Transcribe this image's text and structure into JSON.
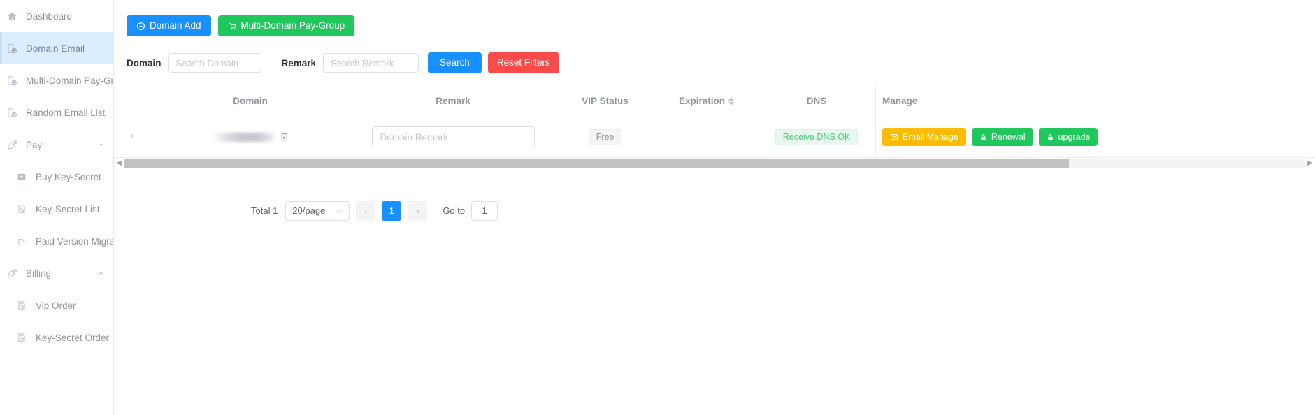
{
  "sidebar": {
    "items": [
      {
        "label": "Dashboard",
        "icon": "home-icon",
        "level": "top",
        "active": false
      },
      {
        "label": "Domain Email",
        "icon": "domain-email-icon",
        "level": "top",
        "active": true
      },
      {
        "label": "Multi-Domain Pay-Group",
        "icon": "domain-email-icon",
        "level": "top",
        "active": false
      },
      {
        "label": "Random Email List",
        "icon": "domain-email-icon",
        "level": "top",
        "active": false
      },
      {
        "label": "Pay",
        "icon": "pay-icon",
        "level": "group",
        "active": false,
        "expanded": true
      },
      {
        "label": "Buy Key-Secret",
        "icon": "key-buy-icon",
        "level": "sub",
        "active": false
      },
      {
        "label": "Key-Secret List",
        "icon": "list-icon",
        "level": "sub",
        "active": false
      },
      {
        "label": "Paid Version Migration",
        "icon": "migration-icon",
        "level": "sub",
        "active": false
      },
      {
        "label": "Billing",
        "icon": "pay-icon",
        "level": "group",
        "active": false,
        "expanded": true
      },
      {
        "label": "Vip Order",
        "icon": "list-icon",
        "level": "sub",
        "active": false
      },
      {
        "label": "Key-Secret Order",
        "icon": "list-icon",
        "level": "sub",
        "active": false
      }
    ]
  },
  "toolbar": {
    "domain_add_label": "Domain Add",
    "multi_domain_label": "Multi-Domain Pay-Group"
  },
  "filters": {
    "domain_label": "Domain",
    "domain_placeholder": "Search Domain",
    "domain_value": "",
    "remark_label": "Remark",
    "remark_placeholder": "Search Remark",
    "remark_value": "",
    "search_label": "Search",
    "reset_label": "Reset Filters"
  },
  "table": {
    "columns": [
      {
        "key": "expander",
        "label": ""
      },
      {
        "key": "domain",
        "label": "Domain"
      },
      {
        "key": "remark",
        "label": "Remark"
      },
      {
        "key": "vip_status",
        "label": "VIP Status"
      },
      {
        "key": "expiration",
        "label": "Expiration",
        "sortable": true
      },
      {
        "key": "dns",
        "label": "DNS"
      },
      {
        "key": "manage",
        "label": "Manage"
      }
    ],
    "rows": [
      {
        "domain": "",
        "domain_redacted": true,
        "remark_value": "",
        "remark_placeholder": "Domain Remark",
        "vip_status": "Free",
        "expiration": "",
        "dns": "Receive DNS OK",
        "actions": [
          {
            "label": "Email Manage",
            "icon": "envelope-icon",
            "style": "yellow"
          },
          {
            "label": "Renewal",
            "icon": "lock-icon",
            "style": "green"
          },
          {
            "label": "upgrade",
            "icon": "lock-icon",
            "style": "green"
          }
        ]
      }
    ]
  },
  "pagination": {
    "total_label": "Total 1",
    "page_size_label": "20/page",
    "prev_label": "‹",
    "next_label": "›",
    "current_page": "1",
    "goto_label": "Go to",
    "goto_value": "1"
  },
  "colors": {
    "primary_blue": "#1890ff",
    "green": "#20c75c",
    "red": "#fa4b4b",
    "yellow": "#fbbc05",
    "dns_green_text": "#49ca78",
    "active_nav_bg": "#dbeeff"
  }
}
